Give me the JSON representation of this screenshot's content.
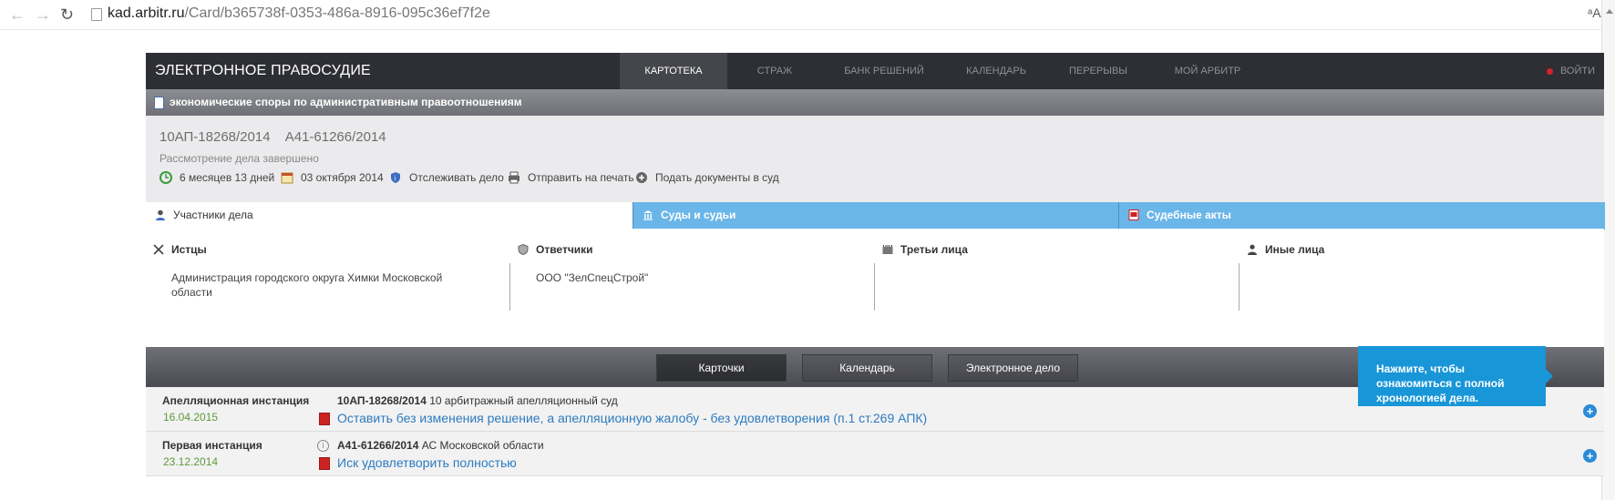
{
  "browser": {
    "url_host": "kad.arbitr.ru",
    "url_path": "/Card/b365738f-0353-486a-8916-095c36ef7f2e",
    "translate_label": "ᵃA"
  },
  "nav": {
    "brand": "ЭЛЕКТРОННОЕ ПРАВОСУДИЕ",
    "items": [
      "КАРТОТЕКА",
      "СТРАЖ",
      "БАНК РЕШЕНИЙ",
      "КАЛЕНДАРЬ",
      "ПЕРЕРЫВЫ",
      "МОЙ АРБИТР"
    ],
    "login": "ВОЙТИ"
  },
  "category": "экономические споры по административным правоотношениям",
  "case": {
    "numbers": [
      "10АП-18268/2014",
      "А41-61266/2014"
    ],
    "status": "Рассмотрение дела завершено",
    "actions": {
      "duration": "6 месяцев 13 дней",
      "date": "03 октября 2014",
      "track": "Отслеживать дело",
      "print": "Отправить на печать",
      "submit": "Подать документы в суд"
    }
  },
  "tabs": {
    "participants": "Участники дела",
    "courts": "Суды и судьи",
    "acts": "Судебные акты"
  },
  "parties": {
    "plaintiffs_title": "Истцы",
    "plaintiffs": "Администрация городского округа Химки Московской области",
    "defendants_title": "Ответчики",
    "defendants": "ООО \"ЗелСпецСтрой\"",
    "third_title": "Третьи лица",
    "other_title": "Иные лица"
  },
  "switcher": [
    "Карточки",
    "Календарь",
    "Электронное дело"
  ],
  "instances": [
    {
      "name": "Апелляционная инстанция",
      "date": "16.04.2015",
      "case_no": "10АП-18268/2014",
      "court": "10 арбитражный апелляционный суд",
      "result": "Оставить без изменения решение, а апелляционную жалобу - без удовлетворения (п.1 ст.269 АПК)"
    },
    {
      "name": "Первая инстанция",
      "date": "23.12.2014",
      "case_no": "А41-61266/2014",
      "court": "АС Московской области",
      "result": "Иск удовлетворить полностью"
    }
  ],
  "tooltip": "Нажмите, чтобы ознакомиться с полной хронологией дела."
}
